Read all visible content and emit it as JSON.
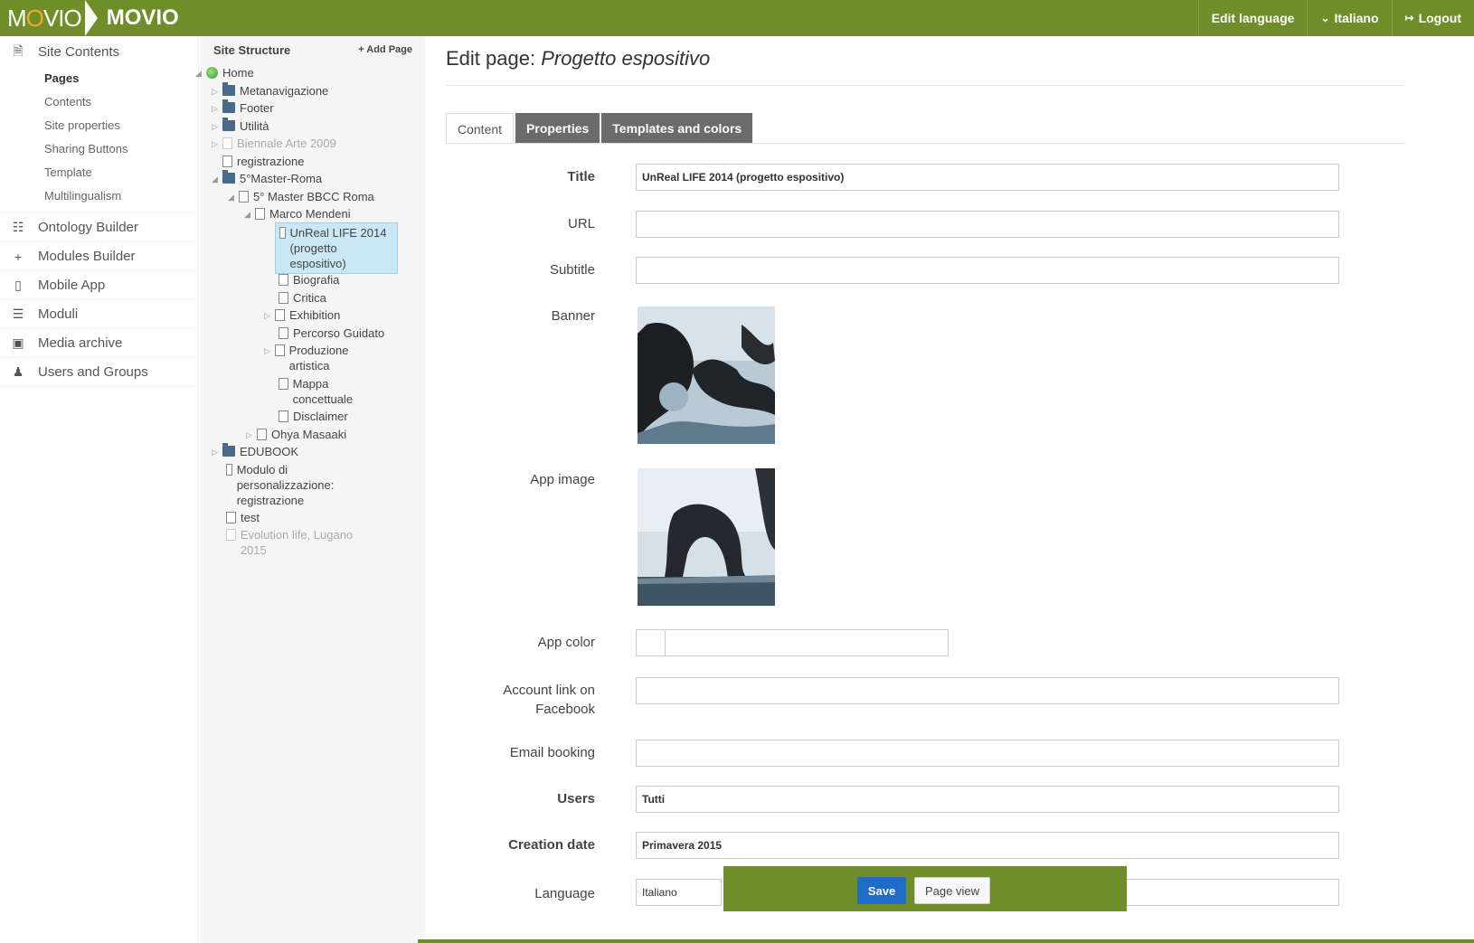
{
  "app": {
    "logo_text": "MOVIO",
    "top_nav": [
      {
        "label": "Edit language",
        "icon": ""
      },
      {
        "label": "Italiano",
        "icon": "chevron-down-icon"
      },
      {
        "label": "Logout",
        "icon": "logout-icon"
      }
    ]
  },
  "sidebar": {
    "site_contents": {
      "label": "Site Contents",
      "icon": "document-icon"
    },
    "sub_items": [
      {
        "label": "Pages",
        "active": true
      },
      {
        "label": "Contents",
        "active": false
      },
      {
        "label": "Site properties",
        "active": false
      },
      {
        "label": "Sharing Buttons",
        "active": false
      },
      {
        "label": "Template",
        "active": false
      },
      {
        "label": "Multilingualism",
        "active": false
      }
    ],
    "items": [
      {
        "label": "Ontology Builder",
        "icon": "sitemap-icon"
      },
      {
        "label": "Modules Builder",
        "icon": "plus-icon"
      },
      {
        "label": "Mobile App",
        "icon": "mobile-icon"
      },
      {
        "label": "Moduli",
        "icon": "list-icon"
      },
      {
        "label": "Media archive",
        "icon": "image-icon"
      },
      {
        "label": "Users and Groups",
        "icon": "user-icon"
      }
    ]
  },
  "tree": {
    "title": "Site Structure",
    "add_label": "Add Page",
    "nodes": [
      {
        "label": "Home"
      },
      {
        "label": "Metanavigazione"
      },
      {
        "label": "Footer"
      },
      {
        "label": "Utilità"
      },
      {
        "label": "Biennale Arte 2009"
      },
      {
        "label": "registrazione"
      },
      {
        "label": "5°Master-Roma"
      },
      {
        "label": "5° Master BBCC Roma"
      },
      {
        "label": "Marco Mendeni"
      },
      {
        "label": "UnReal LIFE 2014 (progetto espositivo)"
      },
      {
        "label": "Biografia"
      },
      {
        "label": "Critica"
      },
      {
        "label": "Exhibition"
      },
      {
        "label": "Percorso Guidato"
      },
      {
        "label": "Produzione artistica"
      },
      {
        "label": "Mappa concettuale"
      },
      {
        "label": "Disclaimer"
      },
      {
        "label": "Ohya Masaaki"
      },
      {
        "label": "EDUBOOK"
      },
      {
        "label": "Modulo di personalizzazione: registrazione"
      },
      {
        "label": "test"
      },
      {
        "label": "Evolution life, Lugano 2015"
      }
    ]
  },
  "main": {
    "title_prefix": "Edit page: ",
    "title_page": "Progetto espositivo",
    "tabs": [
      {
        "label": "Content",
        "active": true
      },
      {
        "label": "Properties",
        "active": false
      },
      {
        "label": "Templates and colors",
        "active": false
      }
    ],
    "fields": {
      "title": {
        "label": "Title",
        "value": "UnReal LIFE 2014 (progetto espositivo)"
      },
      "url": {
        "label": "URL",
        "value": ""
      },
      "subtitle": {
        "label": "Subtitle",
        "value": ""
      },
      "banner": {
        "label": "Banner"
      },
      "app_image": {
        "label": "App image"
      },
      "app_color": {
        "label": "App color",
        "value": ""
      },
      "facebook": {
        "label_1": "Account link on",
        "label_2": "Facebook",
        "value": ""
      },
      "email": {
        "label": "Email booking",
        "value": ""
      },
      "users": {
        "label": "Users",
        "value": "Tutti"
      },
      "creation_date": {
        "label": "Creation date",
        "value": "Primavera 2015"
      },
      "language": {
        "label": "Language",
        "value": "Italiano"
      }
    },
    "buttons": {
      "save": "Save",
      "page_view": "Page view"
    }
  },
  "colors": {
    "brand_green": "#6f8e2a",
    "save_blue": "#1f6cc7",
    "tab_dark": "#6b6b6b",
    "selected_bg": "#c9e7f5"
  }
}
